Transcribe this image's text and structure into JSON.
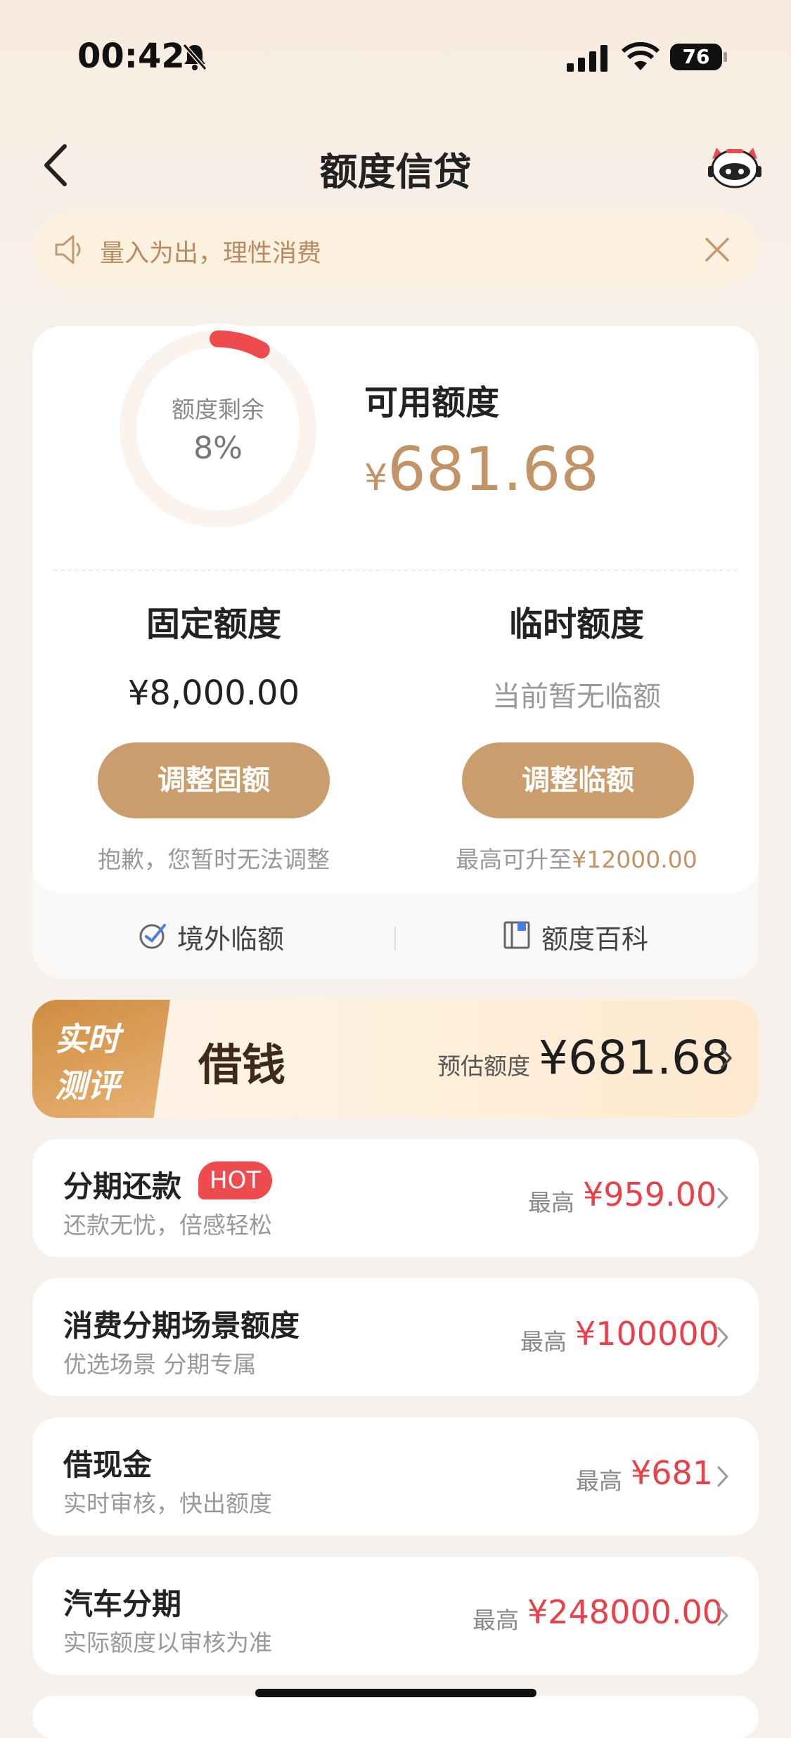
{
  "status": {
    "time": "00:42",
    "battery": "76"
  },
  "nav": {
    "title": "额度信贷"
  },
  "notice": {
    "text": "量入为出，理性消费"
  },
  "credit": {
    "remain_label": "额度剩余",
    "remain_pct": "8%",
    "remain_fraction": 0.08,
    "available_label": "可用额度",
    "currency": "¥",
    "available_amount": "681.68",
    "fixed": {
      "title": "固定额度",
      "value": "¥8,000.00",
      "button": "调整固额",
      "note": "抱歉，您暂时无法调整"
    },
    "temp": {
      "title": "临时额度",
      "value": "当前暂无临额",
      "button": "调整临额",
      "note_prefix": "最高可升至",
      "note_amount": "¥12000.00"
    },
    "links": [
      "境外临额",
      "额度百科"
    ]
  },
  "borrow": {
    "badge_line1": "实时",
    "badge_line2": "测评",
    "title": "借钱",
    "est_label": "预估额度",
    "est_value": "¥681.68"
  },
  "list": [
    {
      "title": "分期还款",
      "hot": "HOT",
      "subtitle": "还款无忧，倍感轻松",
      "prefix": "最高",
      "amount": "¥959.00"
    },
    {
      "title": "消费分期场景额度",
      "subtitle": "优选场景 分期专属",
      "prefix": "最高",
      "amount": "¥100000"
    },
    {
      "title": "借现金",
      "subtitle": "实时审核，快出额度",
      "prefix": "最高",
      "amount": "¥681"
    },
    {
      "title": "汽车分期",
      "subtitle": "实际额度以审核为准",
      "prefix": "最高",
      "amount": "¥248000.00"
    }
  ],
  "colors": {
    "gold": "#c19366",
    "button": "#c99d6c",
    "red": "#e8414a",
    "progress": "#ee4b4f"
  }
}
